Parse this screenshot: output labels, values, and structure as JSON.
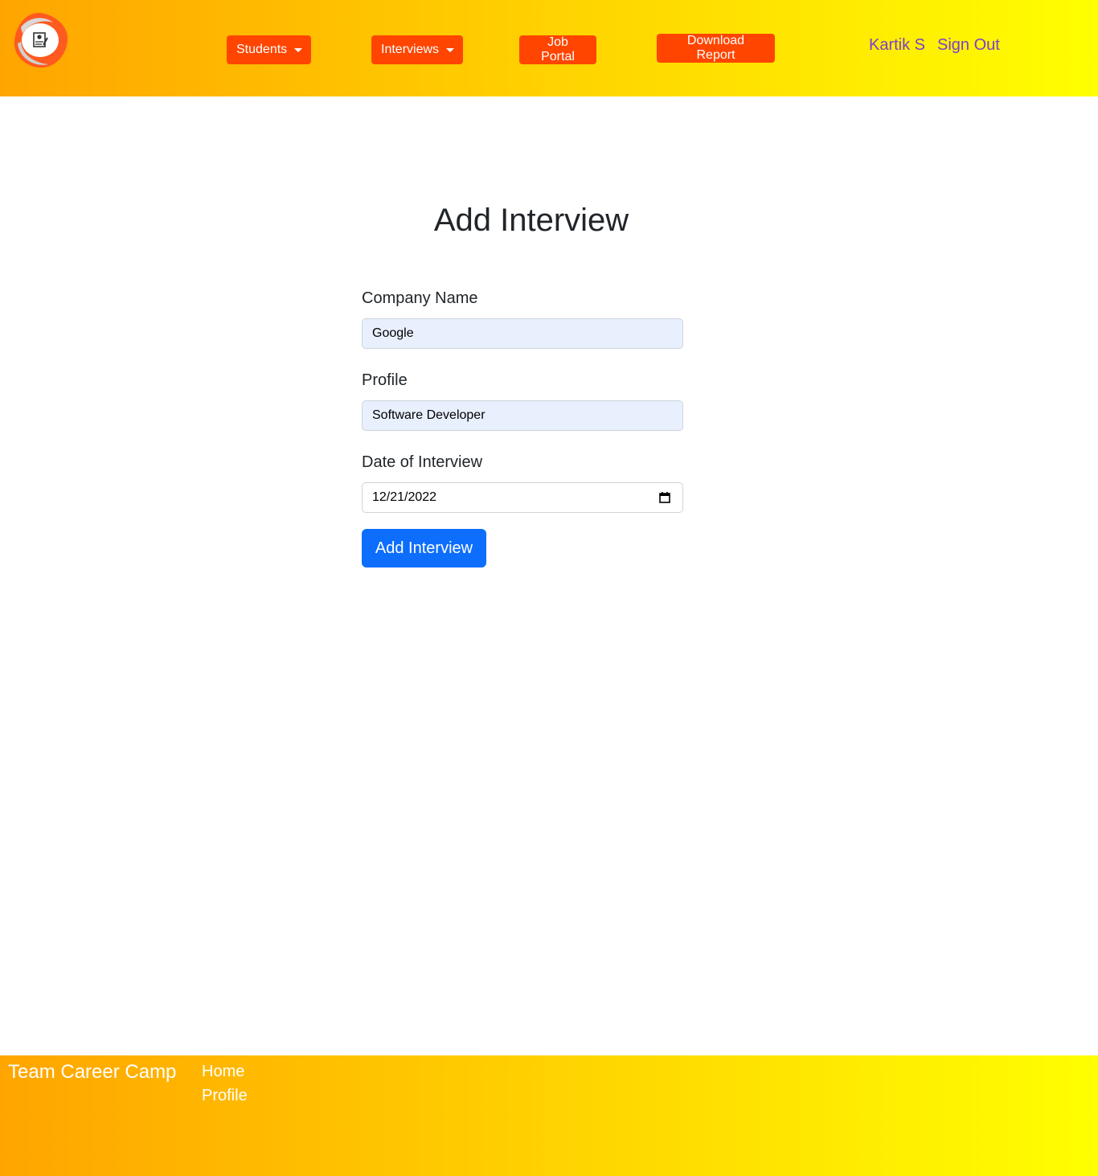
{
  "header": {
    "nav": {
      "students": "Students",
      "interviews": "Interviews",
      "job_portal": "Job Portal",
      "download_report": "Download Report"
    },
    "user_name": "Kartik S",
    "sign_out": "Sign Out"
  },
  "main": {
    "title": "Add Interview",
    "fields": {
      "company_label": "Company Name",
      "company_value": "Google",
      "profile_label": "Profile",
      "profile_value": "Software Developer",
      "date_label": "Date of Interview",
      "date_value": "12/21/2022"
    },
    "submit_label": "Add Interview"
  },
  "footer": {
    "brand": "Team Career Camp",
    "links": [
      "Home",
      "Profile"
    ]
  },
  "colors": {
    "gradient_start": "#ffa500",
    "gradient_end": "#ffff00",
    "nav_button": "#ff4500",
    "primary": "#0d6efd",
    "user_link": "#7b3fd0"
  },
  "icons": [
    "logo-icon",
    "caret-down-icon",
    "calendar-icon"
  ]
}
